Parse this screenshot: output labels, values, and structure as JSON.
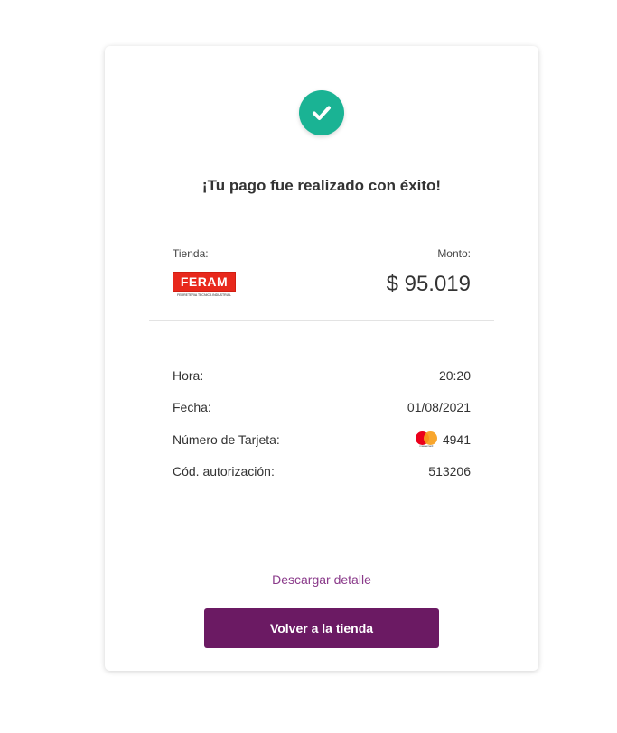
{
  "header": {
    "title": "¡Tu pago fue realizado con éxito!",
    "success_icon": "check-icon",
    "success_color": "#1ab394"
  },
  "store": {
    "label": "Tienda:",
    "logo_text": "FERAM",
    "logo_tagline": "FERRETERIA TECNICA INDUSTRIAL",
    "logo_color": "#e8281c"
  },
  "amount": {
    "label": "Monto:",
    "value": "$ 95.019"
  },
  "details": [
    {
      "label": "Hora:",
      "value": "20:20"
    },
    {
      "label": "Fecha:",
      "value": "01/08/2021"
    },
    {
      "label": "Número de Tarjeta:",
      "value": "4941",
      "icon": "mastercard-icon",
      "icon_text": "mastercard"
    },
    {
      "label": "Cód. autorización:",
      "value": "513206"
    }
  ],
  "actions": {
    "download_label": "Descargar detalle",
    "back_label": "Volver a la tienda",
    "primary_color": "#6b1a63"
  }
}
